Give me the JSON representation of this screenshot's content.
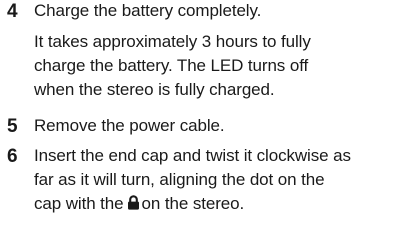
{
  "steps": [
    {
      "number": "4",
      "lines": [
        "Charge the battery completely."
      ]
    },
    {
      "number": "",
      "lines": [
        "It takes approximately 3 hours to fully",
        "charge the battery. The LED turns off",
        "when the stereo is fully charged."
      ]
    },
    {
      "number": "5",
      "lines": [
        "Remove the power cable."
      ]
    },
    {
      "number": "6",
      "lines": [
        "Insert the end cap and twist it clockwise as",
        "far as it will turn, aligning the dot on the"
      ],
      "last_line_before_icon": "cap with the",
      "last_line_after_icon": "on the stereo.",
      "icon": "lock-icon"
    }
  ]
}
